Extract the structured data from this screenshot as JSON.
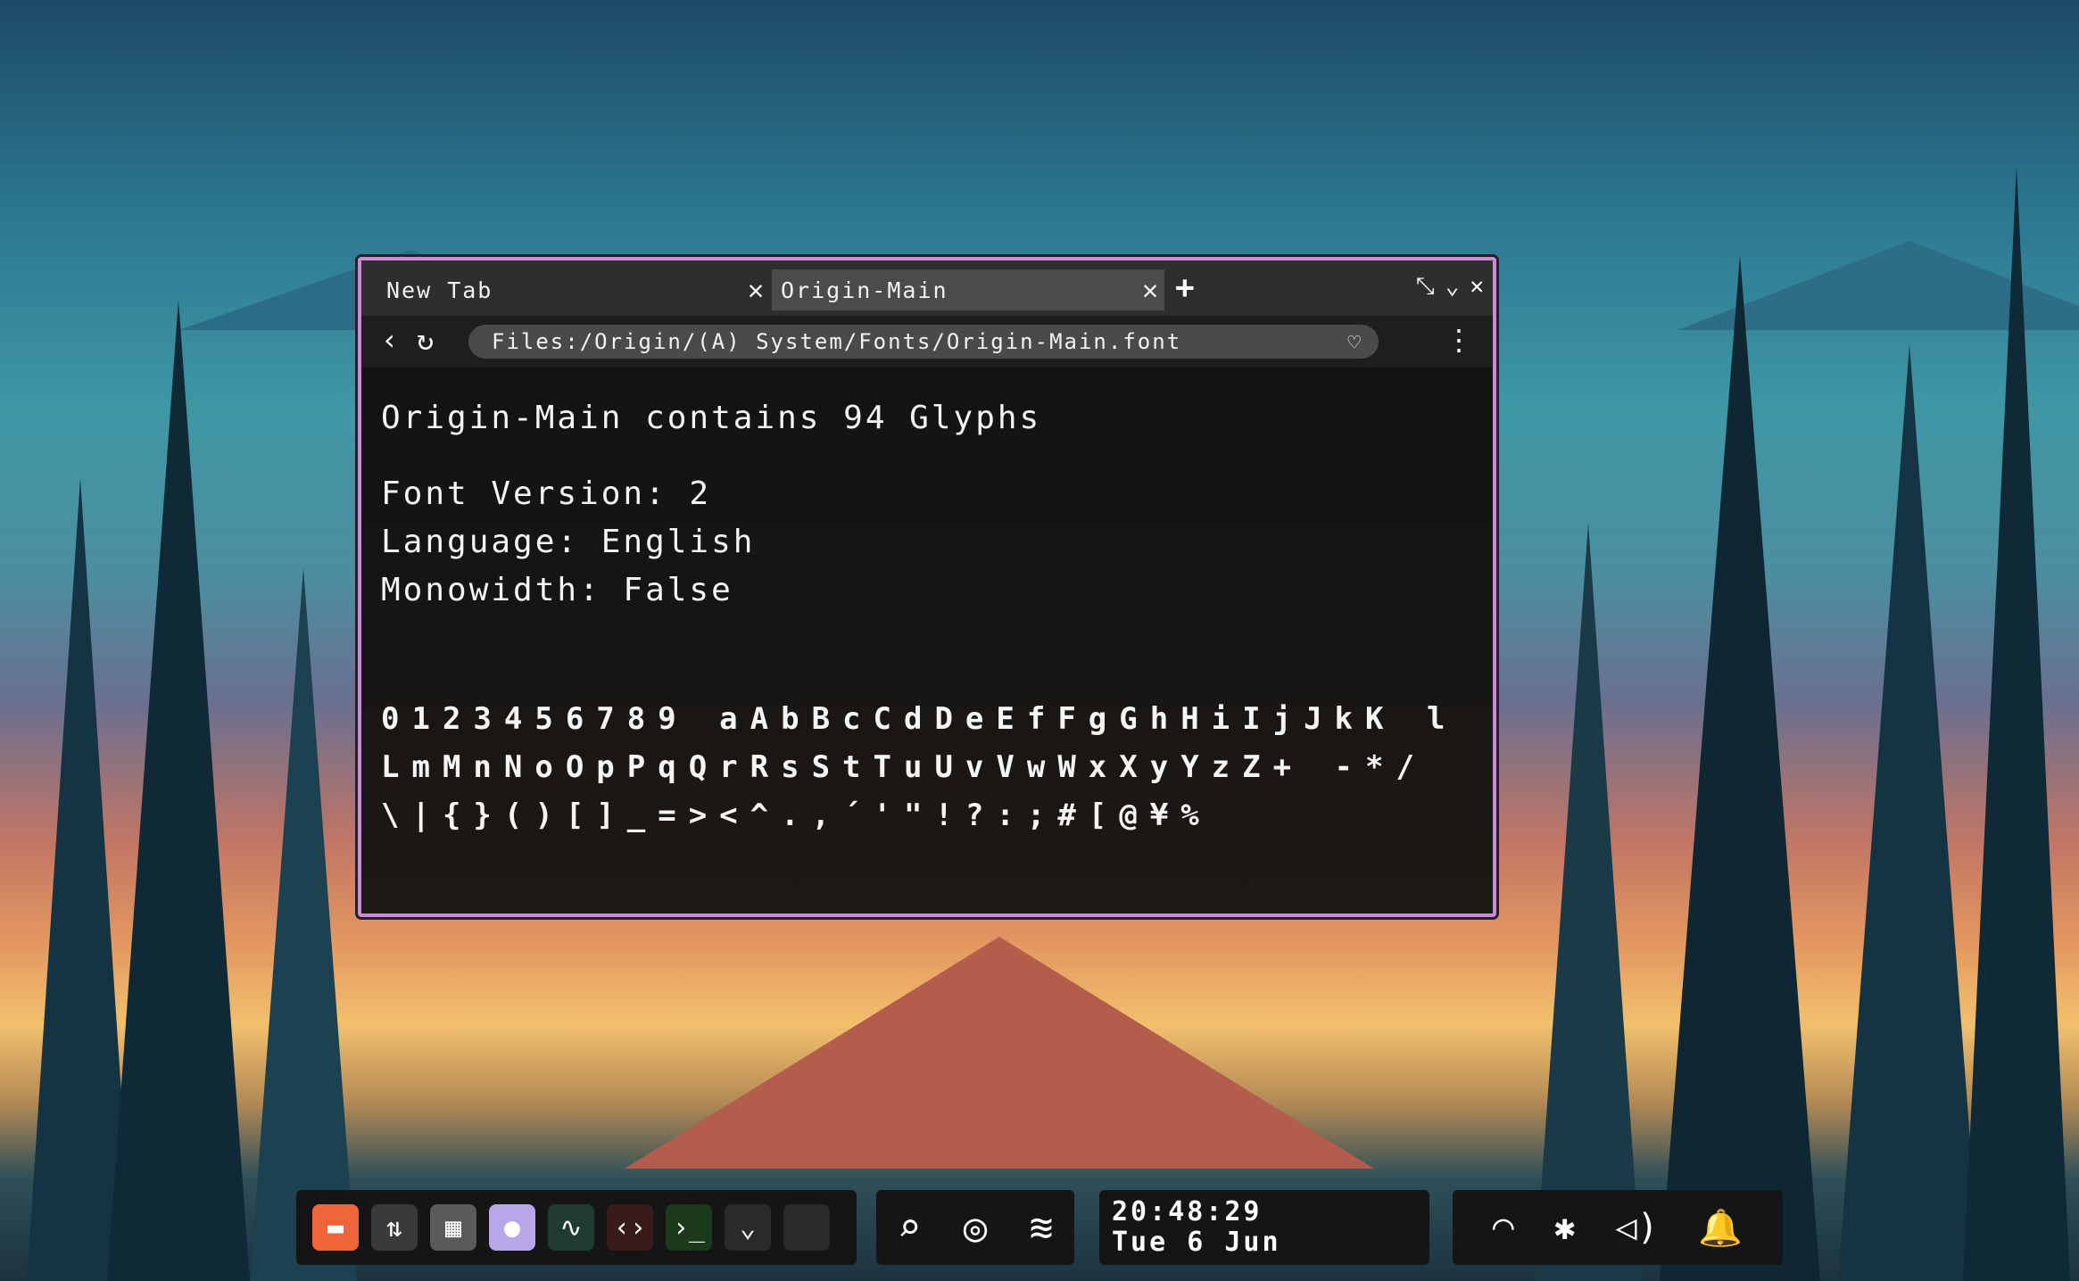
{
  "tabs": [
    {
      "label": "New Tab",
      "close": "✕"
    },
    {
      "label": "Origin-Main",
      "close": "✕"
    }
  ],
  "new_tab": "+",
  "window_controls": {
    "restore": "⤡",
    "minimize": "⌄",
    "close": "✕"
  },
  "nav": {
    "back": "‹",
    "reload": "↻",
    "url": "Files:/Origin/(A) System/Fonts/Origin-Main.font",
    "favorite": "♡",
    "menu": "⋮"
  },
  "content": {
    "headline": "Origin-Main contains 94 Glyphs",
    "meta": [
      "Font Version: 2",
      "Language: English",
      "Monowidth: False"
    ],
    "glyphs": "0123456789 aAbBcCdDeEfFgGhHiIjJkK lLmMnNoOpPqQrRsStTuUvVwWxXyYzZ+ -*/\\|{}()[]_=><^.,´'\"!?:;#[@¥%"
  },
  "dock": {
    "apps": [
      {
        "name": "files",
        "icon": "▬",
        "color": "#f0643a"
      },
      {
        "name": "settings",
        "icon": "⇅",
        "color": "#3a3a3a"
      },
      {
        "name": "calculator",
        "icon": "▦",
        "color": "#5a5a5a"
      },
      {
        "name": "assistant",
        "icon": "●",
        "color": "#b7a6e8"
      },
      {
        "name": "monitor",
        "icon": "∿",
        "color": "#1f3b33"
      },
      {
        "name": "code",
        "icon": "‹›",
        "color": "#3a1b1b"
      },
      {
        "name": "terminal",
        "icon": "›_",
        "color": "#1b3a1b"
      },
      {
        "name": "more",
        "icon": "⌄",
        "color": "#2a2a2a"
      },
      {
        "name": "empty",
        "icon": "",
        "color": "#2a2a2a"
      }
    ]
  },
  "tools": {
    "search": "⌕",
    "activity": "◎",
    "layers": "≋"
  },
  "clock": {
    "time": "20:48:29",
    "date": "Tue 6 Jun"
  },
  "tray": {
    "wifi": "◠",
    "bluetooth": "✱",
    "volume": "◁)",
    "notifications": "🔔"
  }
}
